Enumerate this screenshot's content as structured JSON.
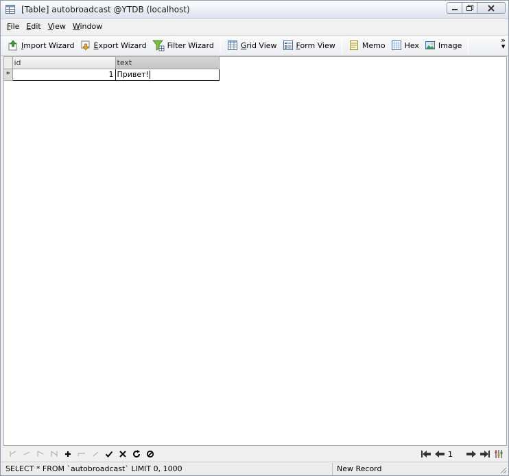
{
  "window": {
    "title": "[Table] autobroadcast @YTDB (localhost)"
  },
  "menu": {
    "items": [
      {
        "key": "F",
        "rest": "ile"
      },
      {
        "key": "E",
        "rest": "dit"
      },
      {
        "key": "V",
        "rest": "iew"
      },
      {
        "key": "W",
        "rest": "indow"
      }
    ]
  },
  "toolbar": {
    "import_key": "I",
    "import_rest": "mport Wizard",
    "export_key": "E",
    "export_rest": "xport Wizard",
    "filter_label": "Filter Wizard",
    "grid_key": "G",
    "grid_rest": "rid View",
    "form_key": "F",
    "form_rest": "orm View",
    "memo_label": "Memo",
    "hex_label": "Hex",
    "image_label": "Image"
  },
  "grid": {
    "columns": [
      "id",
      "text"
    ],
    "sorted_column": "text",
    "rows": [
      {
        "indicator": "*",
        "id": "1",
        "text": "Привет!"
      }
    ]
  },
  "navbar": {
    "page": "1"
  },
  "status": {
    "sql": "SELECT * FROM `autobroadcast` LIMIT 0, 1000",
    "mode": "New Record"
  },
  "colors": {
    "accent_blue": "#2f6fd0",
    "green_check": "#000000",
    "disabled": "#b0b0b0"
  }
}
